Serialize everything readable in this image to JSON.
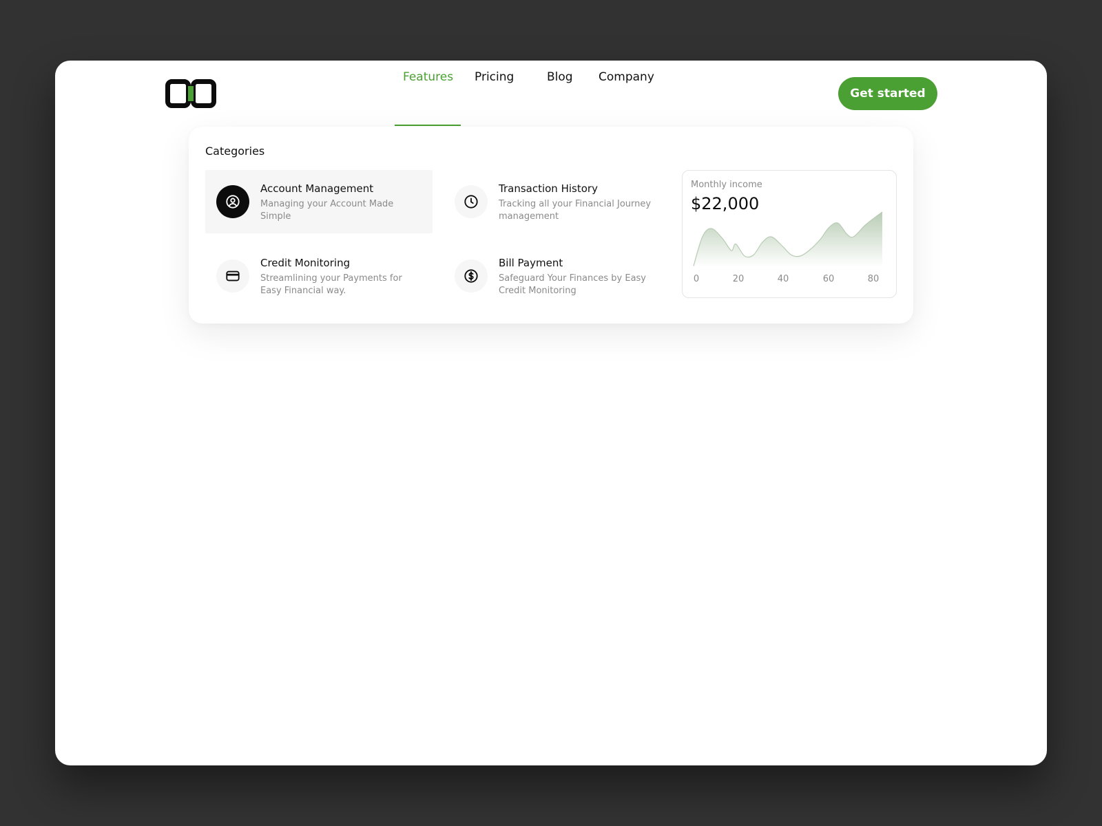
{
  "nav": {
    "items": [
      {
        "label": "Features",
        "active": true
      },
      {
        "label": "Pricing",
        "active": false
      },
      {
        "label": "Blog",
        "active": false
      },
      {
        "label": "Company",
        "active": false
      }
    ],
    "cta_label": "Get started"
  },
  "dropdown": {
    "title": "Categories",
    "categories": [
      {
        "title": "Account Management",
        "description": "Managing your Account Made Simple",
        "icon": "user-circle-icon",
        "highlighted": true
      },
      {
        "title": "Transaction History",
        "description": "Tracking all your Financial Journey management",
        "icon": "clock-icon",
        "highlighted": false
      },
      {
        "title": "Credit Monitoring",
        "description": "Streamlining your Payments for Easy Financial way.",
        "icon": "credit-card-icon",
        "highlighted": false
      },
      {
        "title": "Bill Payment",
        "description": "Safeguard Your Finances by Easy Credit Monitoring",
        "icon": "dollar-circle-icon",
        "highlighted": false
      }
    ]
  },
  "income": {
    "label": "Monthly income",
    "value": "$22,000"
  },
  "chart_data": {
    "type": "area",
    "x_ticks": [
      "0",
      "20",
      "40",
      "60",
      "80"
    ],
    "xlim": [
      0,
      85
    ],
    "x": [
      0,
      4,
      8,
      13,
      17,
      19,
      23,
      27,
      31,
      35,
      40,
      44,
      48,
      52,
      57,
      61,
      65,
      69,
      72,
      77,
      80,
      85
    ],
    "y": [
      0.02,
      0.55,
      0.7,
      0.52,
      0.3,
      0.42,
      0.2,
      0.22,
      0.45,
      0.55,
      0.38,
      0.22,
      0.2,
      0.3,
      0.5,
      0.72,
      0.8,
      0.6,
      0.55,
      0.75,
      0.85,
      1.0
    ],
    "ylim": [
      0,
      1
    ],
    "colors": {
      "line": "#b7ccb3",
      "fill_top": "#b9cdb5",
      "fill_bottom": "#ffffff"
    }
  },
  "colors": {
    "accent": "#4aa032",
    "text_primary": "#111111",
    "text_muted": "#8a8a8a",
    "background": "#323232"
  }
}
